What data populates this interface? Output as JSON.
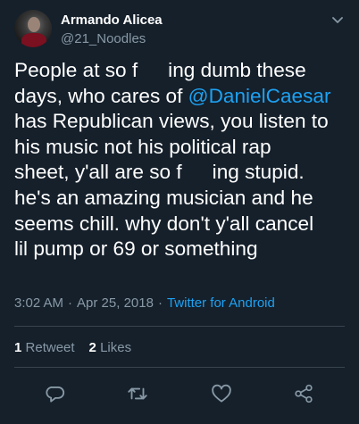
{
  "author": {
    "display_name": "Armando Alicea",
    "handle": "@21_Noodles"
  },
  "tweet": {
    "line1_a": "People at so f",
    "line1_b": "ing dumb these",
    "line2_a": "days, who cares of ",
    "line2_mention": "@DanielCaesar",
    "line3": " has Republican views, you listen to",
    "line4": "his music not his political rap",
    "line5_a": "sheet, y'all are so f",
    "line5_b": "ing stupid.",
    "line6": "he's an amazing musician and he",
    "line7": "seems chill. why don't y'all cancel",
    "line8": "lil pump or 69 or something"
  },
  "meta": {
    "time": "3:02 AM",
    "date": "Apr 25, 2018",
    "separator": "·",
    "source": "Twitter for Android"
  },
  "stats": {
    "retweet_count": "1",
    "retweet_label": "Retweet",
    "like_count": "2",
    "like_label": "Likes"
  },
  "colors": {
    "background": "#15202b",
    "text": "#ffffff",
    "secondary": "#8899a6",
    "accent": "#1da1f2",
    "divider": "#38444d"
  },
  "icons": {
    "menu": "chevron-down-icon",
    "reply": "reply-icon",
    "retweet": "retweet-icon",
    "like": "heart-icon",
    "share": "share-icon"
  }
}
